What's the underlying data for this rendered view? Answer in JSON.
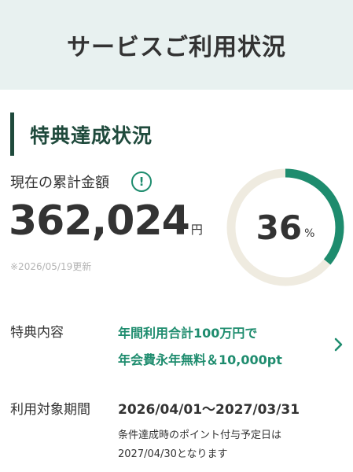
{
  "header": {
    "title": "サービスご利用状況"
  },
  "section": {
    "title": "特典達成状況"
  },
  "total": {
    "label": "現在の累計金額",
    "info_icon": "exclamation-circle-icon",
    "amount": "362,024",
    "unit": "円",
    "updated": "※2026/05/19更新"
  },
  "progress": {
    "value": "36",
    "unit": "%",
    "fraction": 0.36
  },
  "benefit": {
    "label": "特典内容",
    "line1": "年間利用合計100万円で",
    "line2": "年会費永年無料＆10,000pt",
    "chevron_icon": "chevron-right-icon"
  },
  "period": {
    "label": "利用対象期間",
    "value": "2026/04/01〜2027/03/31",
    "note_line1": "条件達成時のポイント付与予定日は",
    "note_line2": "2027/04/30となります"
  },
  "colors": {
    "accent": "#1e8c6e",
    "heading": "#1f4a3c",
    "header_bg": "#e8f1f0",
    "ring_track": "#efebe0"
  }
}
